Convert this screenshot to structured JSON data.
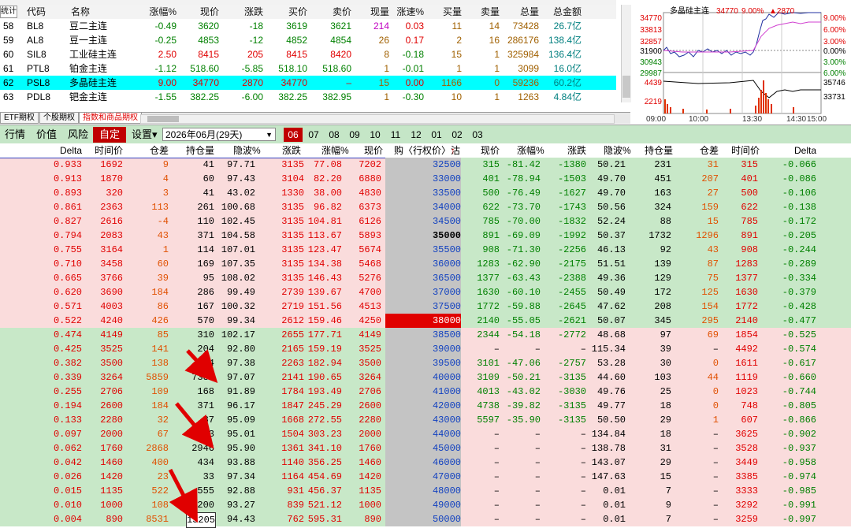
{
  "top_table": {
    "header": {
      "code": "代码",
      "name": "名称",
      "chg_pct": "涨幅%",
      "price": "现价",
      "change": "涨跌",
      "bid": "买价",
      "ask": "卖价",
      "last_vol": "现量",
      "speed": "涨速%",
      "bid_vol": "买量",
      "ask_vol": "卖量",
      "total_vol": "总量",
      "amount": "总金额",
      "corner": "统计"
    },
    "rows": [
      {
        "idx": "58",
        "code": "BL8",
        "name": "豆二主连",
        "chg_pct": "-0.49",
        "price": "3620",
        "change": "-18",
        "bid": "3619",
        "ask": "3621",
        "last_vol": "214",
        "speed": "0.03",
        "bid_vol": "11",
        "ask_vol": "14",
        "total_vol": "73428",
        "amount": "26.7亿",
        "selected": false
      },
      {
        "idx": "59",
        "code": "AL8",
        "name": "豆一主连",
        "chg_pct": "-0.25",
        "price": "4853",
        "change": "-12",
        "bid": "4852",
        "ask": "4854",
        "last_vol": "26",
        "speed": "0.17",
        "bid_vol": "2",
        "ask_vol": "16",
        "total_vol": "286176",
        "amount": "138.4亿",
        "selected": false
      },
      {
        "idx": "60",
        "code": "SIL8",
        "name": "工业硅主连",
        "chg_pct": "2.50",
        "price": "8415",
        "change": "205",
        "bid": "8415",
        "ask": "8420",
        "last_vol": "8",
        "speed": "-0.18",
        "bid_vol": "15",
        "ask_vol": "1",
        "total_vol": "325984",
        "amount": "136.4亿",
        "selected": false
      },
      {
        "idx": "61",
        "code": "PTL8",
        "name": "铂金主连",
        "chg_pct": "-1.12",
        "price": "518.60",
        "change": "-5.85",
        "bid": "518.10",
        "ask": "518.60",
        "last_vol": "1",
        "speed": "-0.01",
        "bid_vol": "1",
        "ask_vol": "1",
        "total_vol": "3099",
        "amount": "16.0亿",
        "selected": false
      },
      {
        "idx": "62",
        "code": "PSL8",
        "name": "多晶硅主连",
        "chg_pct": "9.00",
        "price": "34770",
        "change": "2870",
        "bid": "34770",
        "ask": "–",
        "last_vol": "15",
        "speed": "0.00",
        "bid_vol": "1166",
        "ask_vol": "0",
        "total_vol": "59236",
        "amount": "60.2亿",
        "selected": true
      },
      {
        "idx": "63",
        "code": "PDL8",
        "name": "钯金主连",
        "chg_pct": "-1.55",
        "price": "382.25",
        "change": "-6.00",
        "bid": "382.25",
        "ask": "382.95",
        "last_vol": "1",
        "speed": "-0.30",
        "bid_vol": "10",
        "ask_vol": "1",
        "total_vol": "1263",
        "amount": "4.84亿",
        "selected": false
      }
    ]
  },
  "sheet_tabs": [
    "ETF期权",
    "个股期权",
    "指数和商品期权"
  ],
  "sheet_tabs_active": 2,
  "mini_chart": {
    "title": "多晶硅主连",
    "price": "34770",
    "pct": "9.00%",
    "change": "▲2870",
    "left_ticks": [
      "34770",
      "33813",
      "32857",
      "31900",
      "30943",
      "29987",
      "4439",
      "2219"
    ],
    "right_ticks": [
      "9.00%",
      "6.00%",
      "3.00%",
      "0.00%",
      "3.00%",
      "6.00%",
      "35746",
      "33731"
    ],
    "time_labels": [
      "09:00",
      "10:00",
      "13:30",
      "14:30",
      "15:00"
    ]
  },
  "toolbar": {
    "items": [
      "行情",
      "价值",
      "风险",
      "自定",
      "设置▾"
    ],
    "active": "自定",
    "month_select": "2026年06月(29天)",
    "months": [
      "06",
      "07",
      "08",
      "09",
      "10",
      "11",
      "12",
      "01",
      "02",
      "03"
    ],
    "active_month": "06"
  },
  "option_header": {
    "call": [
      "Delta",
      "时间价",
      "仓差",
      "持仓量",
      "隐波%",
      "涨跌",
      "涨幅%",
      "现价"
    ],
    "strike": "购〈行权价〉沽",
    "strike_arrow": "↑",
    "put": [
      "现价",
      "涨幅%",
      "涨跌",
      "隐波%",
      "持仓量",
      "仓差",
      "时间价",
      "Delta"
    ]
  },
  "colors": {
    "itm_call": "#fadcdc",
    "otm_call": "#c8e8c8",
    "strike_col": "#c4c4c4",
    "selected_row": "#00ffff",
    "toolbar": "#c5e6c7",
    "red": "#e00000",
    "green": "#008000"
  },
  "option_rows": [
    {
      "strike": "32500",
      "call": [
        "0.933",
        "1692",
        "9",
        "41",
        "97.71",
        "3135",
        "77.08",
        "7202"
      ],
      "put": [
        "315",
        "-81.42",
        "-1380",
        "50.21",
        "231",
        "31",
        "315",
        "-0.066"
      ]
    },
    {
      "strike": "33000",
      "call": [
        "0.913",
        "1870",
        "4",
        "60",
        "97.43",
        "3104",
        "82.20",
        "6880"
      ],
      "put": [
        "401",
        "-78.94",
        "-1503",
        "49.70",
        "451",
        "207",
        "401",
        "-0.086"
      ]
    },
    {
      "strike": "33500",
      "call": [
        "0.893",
        "320",
        "3",
        "41",
        "43.02",
        "1330",
        "38.00",
        "4830"
      ],
      "put": [
        "500",
        "-76.49",
        "-1627",
        "49.70",
        "163",
        "27",
        "500",
        "-0.106"
      ]
    },
    {
      "strike": "34000",
      "call": [
        "0.861",
        "2363",
        "113",
        "261",
        "100.68",
        "3135",
        "96.82",
        "6373"
      ],
      "put": [
        "622",
        "-73.70",
        "-1743",
        "50.56",
        "324",
        "159",
        "622",
        "-0.138"
      ]
    },
    {
      "strike": "34500",
      "call": [
        "0.827",
        "2616",
        "-4",
        "110",
        "102.45",
        "3135",
        "104.81",
        "6126"
      ],
      "put": [
        "785",
        "-70.00",
        "-1832",
        "52.24",
        "88",
        "15",
        "785",
        "-0.172"
      ]
    },
    {
      "strike": "35000",
      "call": [
        "0.794",
        "2083",
        "43",
        "371",
        "104.58",
        "3135",
        "113.67",
        "5893"
      ],
      "put": [
        "891",
        "-69.09",
        "-1992",
        "50.37",
        "1732",
        "1296",
        "891",
        "-0.205"
      ]
    },
    {
      "strike": "35500",
      "call": [
        "0.755",
        "3164",
        "1",
        "114",
        "107.01",
        "3135",
        "123.47",
        "5674"
      ],
      "put": [
        "908",
        "-71.30",
        "-2256",
        "46.13",
        "92",
        "43",
        "908",
        "-0.244"
      ]
    },
    {
      "strike": "36000",
      "call": [
        "0.710",
        "3458",
        "60",
        "169",
        "107.35",
        "3135",
        "134.38",
        "5468"
      ],
      "put": [
        "1283",
        "-62.90",
        "-2175",
        "51.51",
        "139",
        "87",
        "1283",
        "-0.289"
      ]
    },
    {
      "strike": "36500",
      "call": [
        "0.665",
        "3766",
        "39",
        "95",
        "108.02",
        "3135",
        "146.43",
        "5276"
      ],
      "put": [
        "1377",
        "-63.43",
        "-2388",
        "49.36",
        "129",
        "75",
        "1377",
        "-0.334"
      ]
    },
    {
      "strike": "37000",
      "call": [
        "0.620",
        "3690",
        "184",
        "286",
        "99.49",
        "2739",
        "139.67",
        "4700"
      ],
      "put": [
        "1630",
        "-60.10",
        "-2455",
        "50.49",
        "172",
        "125",
        "1630",
        "-0.379"
      ]
    },
    {
      "strike": "37500",
      "call": [
        "0.571",
        "4003",
        "86",
        "167",
        "100.32",
        "2719",
        "151.56",
        "4513"
      ],
      "put": [
        "1772",
        "-59.88",
        "-2645",
        "47.62",
        "208",
        "154",
        "1772",
        "-0.428"
      ]
    },
    {
      "strike": "38000",
      "call": [
        "0.522",
        "4240",
        "426",
        "570",
        "99.34",
        "2612",
        "159.46",
        "4250"
      ],
      "put": [
        "2140",
        "-55.05",
        "-2621",
        "50.07",
        "345",
        "295",
        "2140",
        "-0.477"
      ]
    },
    {
      "strike": "38500",
      "call": [
        "0.474",
        "4149",
        "85",
        "310",
        "102.17",
        "2655",
        "177.71",
        "4149"
      ],
      "put": [
        "2344",
        "-54.18",
        "-2772",
        "48.68",
        "97",
        "69",
        "1854",
        "-0.525"
      ]
    },
    {
      "strike": "39000",
      "call": [
        "0.425",
        "3525",
        "141",
        "204",
        "92.80",
        "2165",
        "159.19",
        "3525"
      ],
      "put": [
        "–",
        "–",
        "–",
        "115.34",
        "39",
        "–",
        "4492",
        "-0.574"
      ]
    },
    {
      "strike": "39500",
      "call": [
        "0.382",
        "3500",
        "138",
        "244",
        "97.38",
        "2263",
        "182.94",
        "3500"
      ],
      "put": [
        "3101",
        "-47.06",
        "-2757",
        "53.28",
        "30",
        "0",
        "1611",
        "-0.617"
      ]
    },
    {
      "strike": "40000",
      "call": [
        "0.339",
        "3264",
        "5859",
        "7384",
        "97.07",
        "2141",
        "190.65",
        "3264"
      ],
      "put": [
        "3109",
        "-50.21",
        "-3135",
        "44.60",
        "103",
        "44",
        "1119",
        "-0.660"
      ]
    },
    {
      "strike": "41000",
      "call": [
        "0.255",
        "2706",
        "109",
        "168",
        "91.89",
        "1784",
        "193.49",
        "2706"
      ],
      "put": [
        "4013",
        "-43.02",
        "-3030",
        "49.76",
        "25",
        "0",
        "1023",
        "-0.744"
      ]
    },
    {
      "strike": "42000",
      "call": [
        "0.194",
        "2600",
        "184",
        "371",
        "96.17",
        "1847",
        "245.29",
        "2600"
      ],
      "put": [
        "4738",
        "-39.82",
        "-3135",
        "49.77",
        "18",
        "0",
        "748",
        "-0.805"
      ]
    },
    {
      "strike": "43000",
      "call": [
        "0.133",
        "2280",
        "32",
        "87",
        "95.09",
        "1668",
        "272.55",
        "2280"
      ],
      "put": [
        "5597",
        "-35.90",
        "-3135",
        "50.50",
        "29",
        "1",
        "607",
        "-0.866"
      ]
    },
    {
      "strike": "44000",
      "call": [
        "0.097",
        "2000",
        "67",
        "113",
        "95.01",
        "1504",
        "303.23",
        "2000"
      ],
      "put": [
        "–",
        "–",
        "–",
        "134.84",
        "18",
        "–",
        "3625",
        "-0.902"
      ]
    },
    {
      "strike": "45000",
      "call": [
        "0.062",
        "1760",
        "2868",
        "2946",
        "95.90",
        "1361",
        "341.10",
        "1760"
      ],
      "put": [
        "–",
        "–",
        "–",
        "138.78",
        "31",
        "–",
        "3528",
        "-0.937"
      ]
    },
    {
      "strike": "46000",
      "call": [
        "0.042",
        "1460",
        "400",
        "434",
        "93.88",
        "1140",
        "356.25",
        "1460"
      ],
      "put": [
        "–",
        "–",
        "–",
        "143.07",
        "29",
        "–",
        "3449",
        "-0.958"
      ]
    },
    {
      "strike": "47000",
      "call": [
        "0.026",
        "1420",
        "23",
        "33",
        "97.34",
        "1164",
        "454.69",
        "1420"
      ],
      "put": [
        "–",
        "–",
        "–",
        "147.63",
        "15",
        "–",
        "3385",
        "-0.974"
      ]
    },
    {
      "strike": "48000",
      "call": [
        "0.015",
        "1135",
        "522",
        "555",
        "92.88",
        "931",
        "456.37",
        "1135"
      ],
      "put": [
        "–",
        "–",
        "–",
        "0.01",
        "7",
        "–",
        "3333",
        "-0.985"
      ]
    },
    {
      "strike": "49000",
      "call": [
        "0.010",
        "1000",
        "108",
        "200",
        "93.27",
        "839",
        "521.12",
        "1000"
      ],
      "put": [
        "–",
        "–",
        "–",
        "0.01",
        "9",
        "–",
        "3292",
        "-0.991"
      ]
    },
    {
      "strike": "50000",
      "call": [
        "0.004",
        "890",
        "8531",
        "13205",
        "94.43",
        "762",
        "595.31",
        "890"
      ],
      "put": [
        "–",
        "–",
        "–",
        "0.01",
        "7",
        "–",
        "3259",
        "-0.997"
      ]
    }
  ]
}
